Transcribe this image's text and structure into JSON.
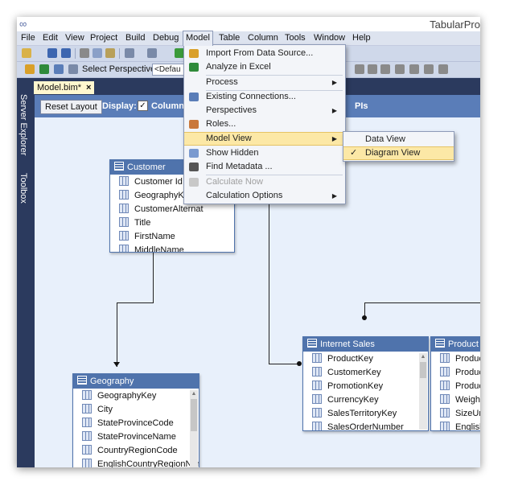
{
  "window": {
    "title": "TabularPro"
  },
  "menubar": {
    "items": [
      "File",
      "Edit",
      "View",
      "Project",
      "Build",
      "Debug",
      "Model",
      "Table",
      "Column",
      "Tools",
      "Window",
      "Help"
    ]
  },
  "toolbar2": {
    "perspective_label": "Select Perspective",
    "perspective_value": "<Defau"
  },
  "sidebar": {
    "server_explorer": "Server Explorer",
    "toolbox": "Toolbox"
  },
  "tab": {
    "label": "Model.bim*",
    "close": "×"
  },
  "diagram_toolbar": {
    "reset_layout": "Reset Layout",
    "display_label": "Display:",
    "columns_label": "Column",
    "kpis_label": "PIs"
  },
  "model_menu": {
    "items": [
      {
        "label": "Import From Data Source...",
        "icon": "database-icon"
      },
      {
        "label": "Analyze in Excel",
        "icon": "excel-icon"
      },
      {
        "label": "Process",
        "submenu": true
      },
      {
        "label": "Existing Connections...",
        "icon": "connections-icon"
      },
      {
        "label": "Perspectives",
        "submenu": true
      },
      {
        "label": "Roles...",
        "icon": "roles-icon"
      },
      {
        "label": "Model View",
        "submenu": true,
        "highlighted": true
      },
      {
        "label": "Show Hidden",
        "icon": "show-hidden-icon"
      },
      {
        "label": "Find Metadata ...",
        "icon": "binoculars-icon"
      },
      {
        "label": "Calculate Now",
        "disabled": true,
        "icon": "calculator-icon"
      },
      {
        "label": "Calculation Options",
        "submenu": true
      }
    ]
  },
  "model_view_submenu": {
    "items": [
      {
        "label": "Data View",
        "checked": false
      },
      {
        "label": "Diagram View",
        "checked": true
      }
    ]
  },
  "tables": {
    "customer": {
      "title": "Customer",
      "columns": [
        "Customer Id",
        "GeographyKey",
        "CustomerAlternat",
        "Title",
        "FirstName",
        "MiddleName"
      ]
    },
    "geography": {
      "title": "Geography",
      "columns": [
        "GeographyKey",
        "City",
        "StateProvinceCode",
        "StateProvinceName",
        "CountryRegionCode",
        "EnglishCountryRegionName"
      ]
    },
    "internet_sales": {
      "title": "Internet Sales",
      "columns": [
        "ProductKey",
        "CustomerKey",
        "PromotionKey",
        "CurrencyKey",
        "SalesTerritoryKey",
        "SalesOrderNumber"
      ]
    },
    "product": {
      "title": "Product",
      "columns": [
        "ProductKey",
        "ProductAlte",
        "ProductSub",
        "WeightUnit",
        "SizeUnitMe",
        "EnglishPro"
      ]
    }
  }
}
